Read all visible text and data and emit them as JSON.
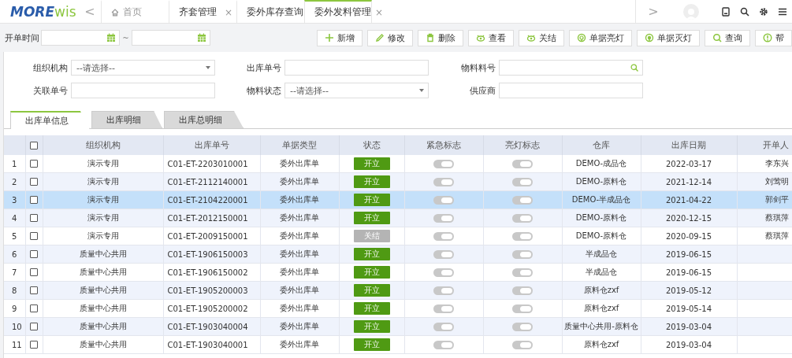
{
  "logo": {
    "main": "MORE",
    "accent": "wis"
  },
  "nav_prev": "<",
  "nav_next": ">",
  "tabs": [
    {
      "label": "首页",
      "kind": "home",
      "selected": false
    },
    {
      "label": "齐套管理",
      "kind": "page",
      "selected": false
    },
    {
      "label": "委外库存查询",
      "kind": "page",
      "selected": false
    },
    {
      "label": "委外发料管理",
      "kind": "page",
      "selected": true
    }
  ],
  "close_mark": "×",
  "date_filter": {
    "label": "开单时间",
    "separator": "~"
  },
  "actions": [
    "新增",
    "修改",
    "删除",
    "查看",
    "关结",
    "单据亮灯",
    "单据灭灯",
    "查询",
    "帮"
  ],
  "filters": [
    {
      "label": "组织机构",
      "kind": "select",
      "placeholder": "--请选择--"
    },
    {
      "label": "出库单号",
      "kind": "text"
    },
    {
      "label": "物料料号",
      "kind": "search"
    },
    {
      "label": "关联单号",
      "kind": "text"
    },
    {
      "label": "物料状态",
      "kind": "select",
      "placeholder": "--请选择--"
    },
    {
      "label": "供应商",
      "kind": "text"
    }
  ],
  "sub_tabs": [
    {
      "label": "出库单信息",
      "selected": true
    },
    {
      "label": "出库明细",
      "selected": false
    },
    {
      "label": "出库总明细",
      "selected": false
    }
  ],
  "table": {
    "select_all": {
      "checked": false
    },
    "columns": [
      "组织机构",
      "出库单号",
      "单据类型",
      "状态",
      "紧急标志",
      "亮灯标志",
      "仓库",
      "出库日期",
      "开单人"
    ],
    "rows": [
      {
        "index": "1",
        "checked": false,
        "selected": false,
        "org": "演示专用",
        "number": "C01-ET-2203010001",
        "type": "委外出库单",
        "status": {
          "label": "开立",
          "kind": "open"
        },
        "urgent": false,
        "light": false,
        "warehouse": "DEMO-成品仓",
        "date": "2022-03-17",
        "creator": "李东兴"
      },
      {
        "index": "2",
        "checked": false,
        "selected": false,
        "org": "演示专用",
        "number": "C01-ET-2112140001",
        "type": "委外出库单",
        "status": {
          "label": "开立",
          "kind": "open"
        },
        "urgent": false,
        "light": false,
        "warehouse": "DEMO-原料仓",
        "date": "2021-12-14",
        "creator": "刘莺明"
      },
      {
        "index": "3",
        "checked": false,
        "selected": true,
        "org": "演示专用",
        "number": "C01-ET-2104220001",
        "type": "委外出库单",
        "status": {
          "label": "开立",
          "kind": "open"
        },
        "urgent": false,
        "light": false,
        "warehouse": "DEMO-半成品仓",
        "date": "2021-04-22",
        "creator": "郭剑平"
      },
      {
        "index": "4",
        "checked": false,
        "selected": false,
        "org": "演示专用",
        "number": "C01-ET-2012150001",
        "type": "委外出库单",
        "status": {
          "label": "开立",
          "kind": "open"
        },
        "urgent": false,
        "light": false,
        "warehouse": "DEMO-原料仓",
        "date": "2020-12-15",
        "creator": "蔡琪萍"
      },
      {
        "index": "5",
        "checked": false,
        "selected": false,
        "org": "演示专用",
        "number": "C01-ET-2009150001",
        "type": "委外出库单",
        "status": {
          "label": "关结",
          "kind": "closed"
        },
        "urgent": false,
        "light": false,
        "warehouse": "DEMO-原料仓",
        "date": "2020-09-15",
        "creator": "蔡琪萍"
      },
      {
        "index": "6",
        "checked": false,
        "selected": false,
        "org": "质量中心共用",
        "number": "C01-ET-1906150003",
        "type": "委外出库单",
        "status": {
          "label": "开立",
          "kind": "open"
        },
        "urgent": false,
        "light": false,
        "warehouse": "半成品仓",
        "date": "2019-06-15"
      },
      {
        "index": "7",
        "checked": false,
        "selected": false,
        "org": "质量中心共用",
        "number": "C01-ET-1906150002",
        "type": "委外出库单",
        "status": {
          "label": "开立",
          "kind": "open"
        },
        "urgent": false,
        "light": false,
        "warehouse": "半成品仓",
        "date": "2019-06-15"
      },
      {
        "index": "8",
        "checked": false,
        "selected": false,
        "org": "质量中心共用",
        "number": "C01-ET-1905200003",
        "type": "委外出库单",
        "status": {
          "label": "开立",
          "kind": "open"
        },
        "urgent": false,
        "light": false,
        "warehouse": "原料仓zxf",
        "date": "2019-05-12"
      },
      {
        "index": "9",
        "checked": false,
        "selected": false,
        "org": "质量中心共用",
        "number": "C01-ET-1905200002",
        "type": "委外出库单",
        "status": {
          "label": "开立",
          "kind": "open"
        },
        "urgent": false,
        "light": false,
        "warehouse": "原料仓zxf",
        "date": "2019-05-14"
      },
      {
        "index": "10",
        "checked": false,
        "selected": false,
        "org": "质量中心共用",
        "number": "C01-ET-1903040004",
        "type": "委外出库单",
        "status": {
          "label": "开立",
          "kind": "open"
        },
        "urgent": false,
        "light": false,
        "warehouse": "质量中心共用-原料仓",
        "date": "2019-03-04"
      },
      {
        "index": "11",
        "checked": false,
        "selected": false,
        "org": "质量中心共用",
        "number": "C01-ET-1903040001",
        "type": "委外出库单",
        "status": {
          "label": "开立",
          "kind": "open"
        },
        "urgent": false,
        "light": false,
        "warehouse": "原料仓zxf",
        "date": "2019-03-04"
      }
    ]
  }
}
